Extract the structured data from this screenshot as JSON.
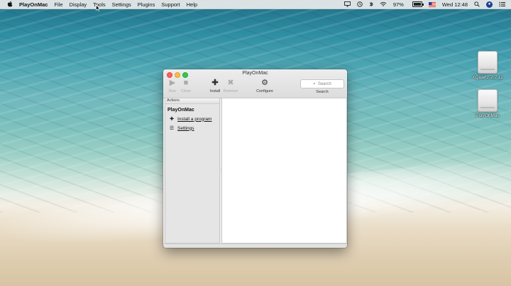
{
  "menubar": {
    "apple_icon": "apple-icon",
    "items": [
      "PlayOnMac",
      "File",
      "Display",
      "Tools",
      "Settings",
      "Plugins",
      "Support",
      "Help"
    ],
    "status": {
      "battery_percent": "97%",
      "battery_level": 0.97,
      "clock": "Wed 12:48"
    }
  },
  "desktop": {
    "icons": [
      {
        "label": "XQuartz-2.7.11",
        "icon": "disk-icon"
      },
      {
        "label": "PlayOnMac",
        "icon": "disk-icon"
      }
    ]
  },
  "window": {
    "title": "PlayOnMac",
    "toolbar": {
      "run": "Run",
      "close": "Close",
      "install": "Install",
      "remove": "Remove",
      "configure": "Configure",
      "search_placeholder": "Search",
      "search_label": "Search"
    },
    "sidebar": {
      "section_header": "Actions",
      "app_name": "PlayOnMac",
      "actions": [
        {
          "label": "Install a program",
          "icon": "plus-icon"
        },
        {
          "label": "Settings",
          "icon": "list-icon"
        }
      ]
    }
  },
  "colors": {
    "traffic_close": "#fc605c",
    "traffic_minimize": "#fdbc40",
    "traffic_maximize": "#34c84a"
  }
}
